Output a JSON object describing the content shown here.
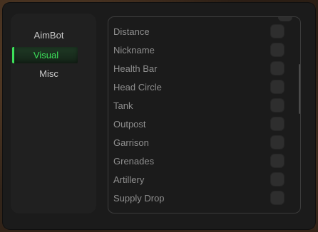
{
  "sidebar": {
    "items": [
      {
        "label": "AimBot",
        "active": false
      },
      {
        "label": "Visual",
        "active": true
      },
      {
        "label": "Misc",
        "active": false
      }
    ]
  },
  "panel": {
    "options": [
      {
        "label": "Distance",
        "enabled": false
      },
      {
        "label": "Nickname",
        "enabled": false
      },
      {
        "label": "Health Bar",
        "enabled": false
      },
      {
        "label": "Head Circle",
        "enabled": false
      },
      {
        "label": "Tank",
        "enabled": false
      },
      {
        "label": "Outpost",
        "enabled": false
      },
      {
        "label": "Garrison",
        "enabled": false
      },
      {
        "label": "Grenades",
        "enabled": false
      },
      {
        "label": "Artillery",
        "enabled": false
      },
      {
        "label": "Supply Drop",
        "enabled": false
      }
    ]
  },
  "colors": {
    "accent": "#3de05a",
    "panel_bg": "#1b1b1b",
    "sidebar_bg": "#202020",
    "toggle_bg": "#2e2e2e",
    "text_muted": "#8f8f8f"
  }
}
